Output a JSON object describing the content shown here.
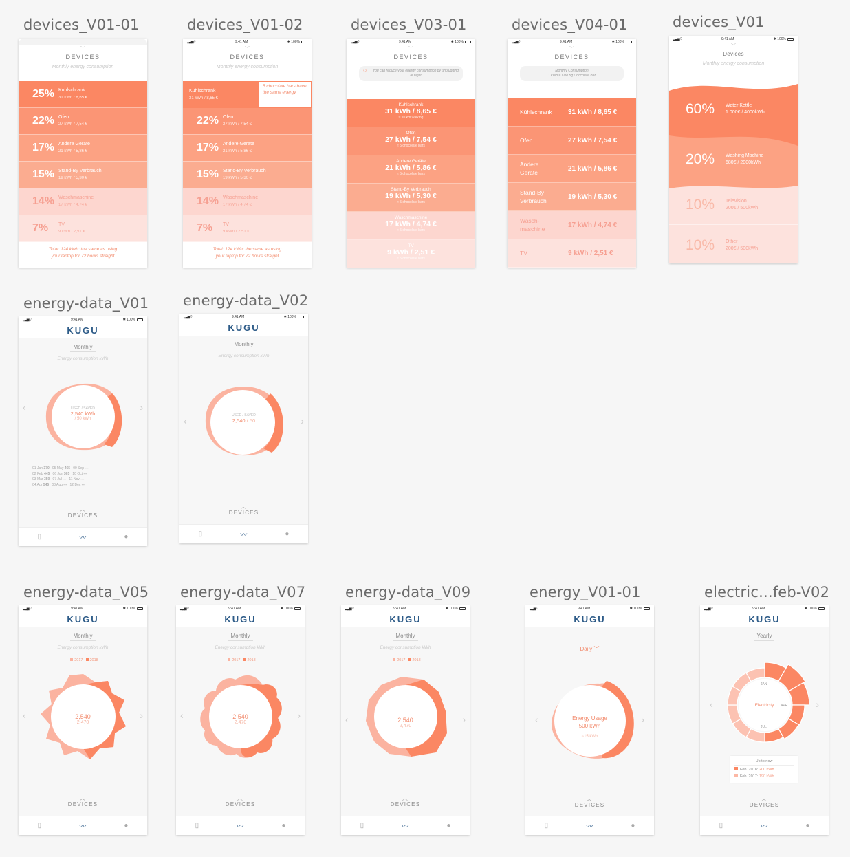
{
  "artboards": {
    "a1": {
      "label": "devices_V01-01"
    },
    "a2": {
      "label": "devices_V01-02",
      "time": "9:41 AM",
      "battery": "100%"
    },
    "a3": {
      "label": "devices_V03-01",
      "time": "9:41 AM",
      "battery": "100%"
    },
    "a4": {
      "label": "devices_V04-01",
      "time": "9:41 AM",
      "battery": "100%"
    },
    "a5": {
      "label": "devices_V01",
      "time": "9:41 AM",
      "battery": "100%"
    },
    "b1": {
      "label": "energy-data_V01",
      "time": "9:41 AM",
      "battery": "100%"
    },
    "b2": {
      "label": "energy-data_V02",
      "time": "9:41 AM",
      "battery": "100%"
    },
    "c1": {
      "label": "energy-data_V05",
      "time": "9:41 AM",
      "battery": "100%"
    },
    "c2": {
      "label": "energy-data_V07",
      "time": "9:41 AM",
      "battery": "100%"
    },
    "c3": {
      "label": "energy-data_V09",
      "time": "9:41 AM",
      "battery": "100%"
    },
    "c4": {
      "label": "energy_V01-01",
      "time": "9:41 AM",
      "battery": "100%"
    },
    "c5": {
      "label": "electric...feb-V02",
      "time": "9:41 AM",
      "battery": "100%"
    }
  },
  "devices": {
    "title": "DEVICES",
    "subtitle": "Monthly energy consumption",
    "rows": [
      {
        "pct": "25%",
        "name": "Kuhlschrank",
        "detail": "31 kWh / 8,65 €"
      },
      {
        "pct": "22%",
        "name": "Ofen",
        "detail": "27 kWh / 7,54 €"
      },
      {
        "pct": "17%",
        "name": "Andere Geräte",
        "detail": "21 kWh / 5,86 €"
      },
      {
        "pct": "15%",
        "name": "Stand-By Verbrauch",
        "detail": "19 kWh / 5,30 €"
      },
      {
        "pct": "14%",
        "name": "Waschmaschine",
        "detail": "17 kWh / 4,74 €"
      },
      {
        "pct": "7%",
        "name": "TV",
        "detail": "9 kWh / 2,51 €"
      }
    ],
    "footer_line1": "Total: 124 kWh: the same as using",
    "footer_line2": "your laptop for 72 hours straight",
    "callout": "5 chocolate bars have the same energy",
    "v2_footer_line1": "Total: 124 kWh: the same as using",
    "v2_footer_line2": "your laptop for 72 hours straight"
  },
  "v03": {
    "tip": "You can reduce your energy consumption by unplugging at night",
    "rows": [
      {
        "name": "Kuhlschrank",
        "value": "31 kWh / 8,65 €",
        "sub": "≈ 10 km walking"
      },
      {
        "name": "Ofen",
        "value": "27 kWh / 7,54 €",
        "sub": "≈ 5 chocolate bars"
      },
      {
        "name": "Andere Geräte",
        "value": "21 kWh / 5,86 €",
        "sub": "≈ 5 chocolate bars"
      },
      {
        "name": "Stand-By Verbrauch",
        "value": "19 kWh / 5,30 €",
        "sub": "≈ 5 chocolate bars"
      },
      {
        "name": "Waschmaschine",
        "value": "17 kWh / 4,74 €",
        "sub": "≈ 5 chocolate bars"
      },
      {
        "name": "TV",
        "value": "9 kWh / 2,51 €",
        "sub": "≈ 5 chocolate bars"
      }
    ]
  },
  "v04": {
    "tip_line1": "Monthly Consumption",
    "tip_line2": "1 kWh = One 5g Chocolate Bar",
    "rows": [
      {
        "name": "Kühlschrank",
        "value": "31 kWh / 8,65 €"
      },
      {
        "name": "Ofen",
        "value": "27 kWh / 7,54 €"
      },
      {
        "name": "Andere Geräte",
        "value": "21 kWh / 5,86 €"
      },
      {
        "name": "Stand-By Verbrauch",
        "value": "19 kWh / 5,30 €"
      },
      {
        "name": "Wasch- maschine",
        "value": "17 kWh / 4,74 €"
      },
      {
        "name": "TV",
        "value": "9 kWh / 2,51 €"
      }
    ]
  },
  "v01": {
    "title": "Devices",
    "subtitle": "Monthly energy consumption",
    "rows": [
      {
        "pct": "60%",
        "name": "Water Kettle",
        "detail": "1.000€ / 4000kWh"
      },
      {
        "pct": "20%",
        "name": "Washing Machine",
        "detail": "680€ / 2000kWh"
      },
      {
        "pct": "10%",
        "name": "Television",
        "detail": "200€ / 500kWh"
      },
      {
        "pct": "10%",
        "name": "Other",
        "detail": "200€ / 500kWh"
      }
    ]
  },
  "energy": {
    "brand": "KUGU",
    "monthly": "Monthly",
    "daily": "Daily",
    "yearly": "Yearly",
    "subtitle": "Energy consumption kWh",
    "devices": "DEVICES",
    "used_saved": "USED / SAVED",
    "v01_value": "2,540 kWh",
    "v01_saved": "/ 50 kWh",
    "v02_value": "2,540",
    "v02_saved": "/ 50",
    "v05_value": "2,540",
    "v05_prev": "2,470",
    "legend_2017": "2017",
    "legend_2018": "2018",
    "energy_usage": "Energy Usage",
    "energy_kwh": "500 kWh",
    "energy_delta": "~15 kWh",
    "electricity": "Electricity",
    "jan": "JAN",
    "apr": "APR",
    "jul": "JUL",
    "up_to_now": "Up to now",
    "feb2018": "Feb. 2018:",
    "feb2018_v": "200 kWh",
    "feb2017": "Feb. 2017:",
    "feb2017_v": "190 kWh",
    "table": [
      [
        "01 Jan",
        "370",
        "05 May",
        "465",
        "09 Sep",
        "---"
      ],
      [
        "02 Feb",
        "445",
        "06 Jun",
        "365",
        "10 Oct",
        "---"
      ],
      [
        "03 Mar",
        "350",
        "07 Jul",
        "---",
        "11 Nov",
        "---"
      ],
      [
        "04 Apr",
        "545",
        "08 Aug",
        "---",
        "12 Dec",
        "---"
      ]
    ]
  },
  "colors": {
    "accent": "#fb8763",
    "light": "#fde2dd",
    "brand": "#2d5b88"
  }
}
